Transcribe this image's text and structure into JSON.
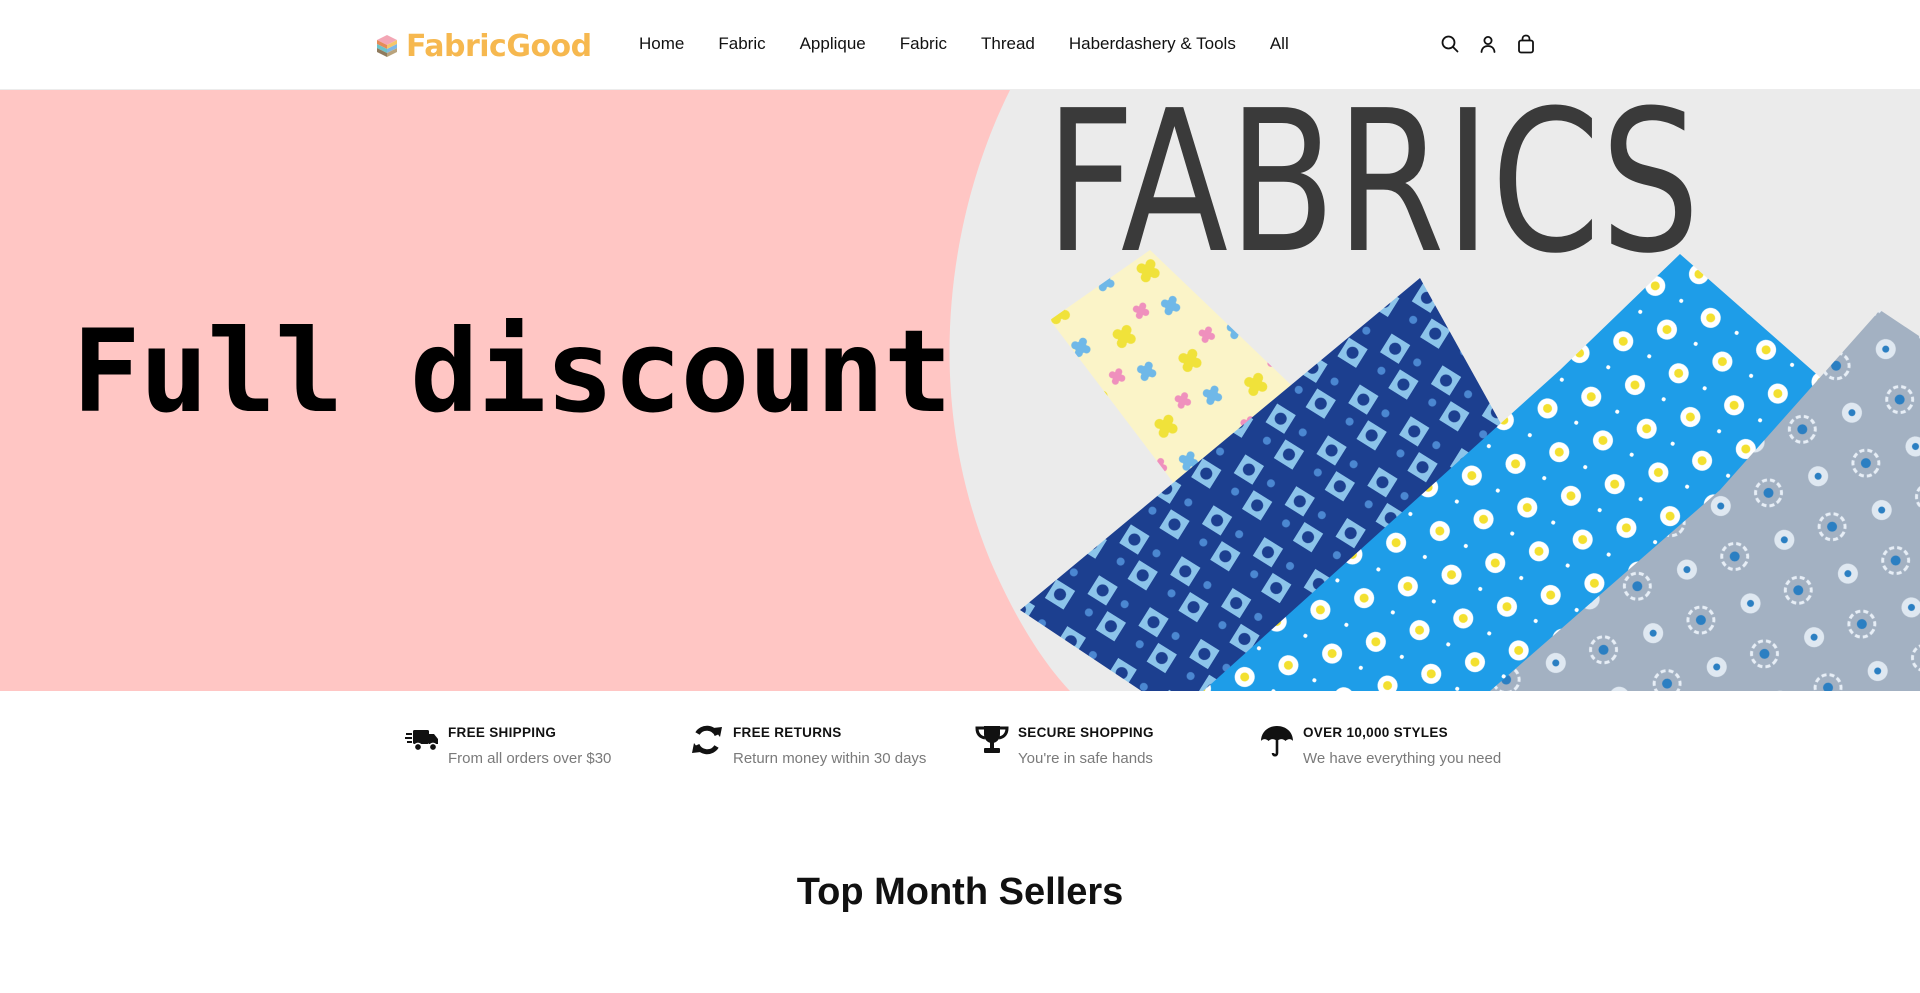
{
  "brand": {
    "name": "FabricGood"
  },
  "nav": {
    "items": [
      {
        "label": "Home"
      },
      {
        "label": "Fabric"
      },
      {
        "label": "Applique"
      },
      {
        "label": "Fabric"
      },
      {
        "label": "Thread"
      },
      {
        "label": "Haberdashery & Tools"
      },
      {
        "label": "All"
      }
    ]
  },
  "header_icons": [
    "search-icon",
    "account-icon",
    "cart-icon"
  ],
  "hero": {
    "headline": "Full discount",
    "image_text": "FABRICS",
    "background_color": "#ffc6c4"
  },
  "features": [
    {
      "icon": "truck-icon",
      "title": "FREE SHIPPING",
      "subtitle": "From all orders over $30"
    },
    {
      "icon": "refresh-icon",
      "title": "FREE RETURNS",
      "subtitle": "Return money within 30 days"
    },
    {
      "icon": "trophy-icon",
      "title": "SECURE SHOPPING",
      "subtitle": "You're in safe hands"
    },
    {
      "icon": "umbrella-icon",
      "title": "OVER 10,000 STYLES",
      "subtitle": "We have everything you need"
    }
  ],
  "sections": {
    "top_sellers_title": "Top Month Sellers"
  },
  "colors": {
    "brand": "#f6b84f",
    "text": "#111111",
    "muted": "#7a7a7a"
  }
}
